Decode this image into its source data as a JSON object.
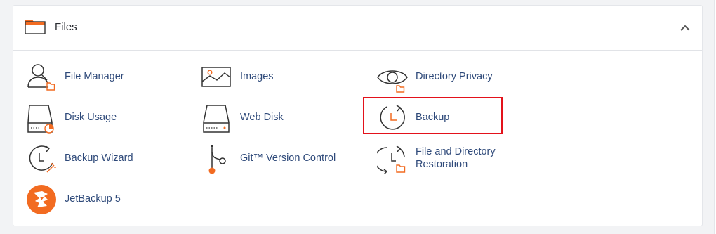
{
  "section": {
    "title": "Files",
    "icon": "folder-icon",
    "collapse_icon": "chevron-up-icon"
  },
  "items": [
    {
      "label": "File Manager",
      "icon": "file-manager-icon"
    },
    {
      "label": "Images",
      "icon": "images-icon"
    },
    {
      "label": "Directory Privacy",
      "icon": "directory-privacy-icon"
    },
    {
      "label": "Disk Usage",
      "icon": "disk-usage-icon"
    },
    {
      "label": "Web Disk",
      "icon": "web-disk-icon"
    },
    {
      "label": "Backup",
      "icon": "backup-icon",
      "highlighted": true
    },
    {
      "label": "Backup Wizard",
      "icon": "backup-wizard-icon"
    },
    {
      "label": "Git™ Version Control",
      "icon": "git-icon"
    },
    {
      "label_line1": "File and Directory",
      "label_line2": "Restoration",
      "icon": "file-restoration-icon"
    },
    {
      "label": "JetBackup 5",
      "icon": "jetbackup-icon"
    }
  ],
  "colors": {
    "accent": "#f26b21",
    "link": "#2f4a7a",
    "icon_stroke": "#333333",
    "highlight_border": "#e3121b"
  }
}
